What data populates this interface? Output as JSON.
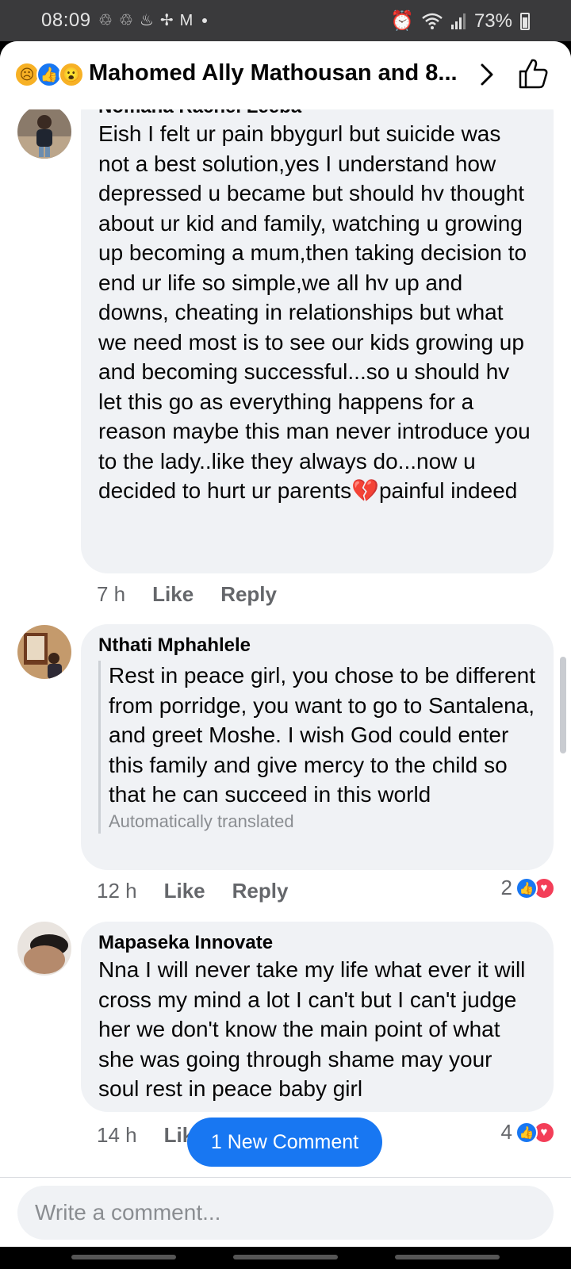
{
  "status_bar": {
    "time": "08:09",
    "battery": "73%",
    "left_icons": [
      "sync-icon",
      "sync-icon",
      "notification-icon",
      "fan-icon",
      "gmail-icon"
    ],
    "right_icons": [
      "alarm-icon",
      "wifi-icon",
      "signal-icon",
      "battery-icon"
    ]
  },
  "header": {
    "reactions": [
      "sad-reaction-icon",
      "like-reaction-icon",
      "wow-reaction-icon"
    ],
    "title": "Mahomed Ally Mathousan and 8..."
  },
  "comments": [
    {
      "author": "Nomana Rachel Leeba",
      "text": "Eish I felt ur pain bbygurl but suicide was not a best solution,yes I understand how depressed u became but should hv thought about ur kid and family, watching u growing up becoming a mum,then taking decision to end ur life so simple,we all hv up and downs, cheating in relationships but what we need most is to see our kids growing up and becoming successful...so  u should hv let this go as everything happens for a reason maybe this man never introduce you to the lady..like they always do...now u decided to hurt ur parents",
      "emoji": "💔",
      "text_after": "painful indeed",
      "time": "7 h",
      "like": "Like",
      "reply": "Reply"
    },
    {
      "author": "Nthati Mphahlele",
      "text": "Rest in peace girl, you chose to be different from porridge, you want to go to Santalena, and greet Moshe. I wish God could enter this family and give mercy to the child so that he can succeed in this world",
      "translated_note": "Automatically translated",
      "time": "12 h",
      "like": "Like",
      "reply": "Reply",
      "reaction_count": "2"
    },
    {
      "author": "Mapaseka Innovate",
      "text": "Nna I will never take my life what ever it will cross my mind a lot I can't but I can't judge her we don't know the main point of what she was going through shame may your soul rest in peace baby girl",
      "time": "14 h",
      "like": "Like",
      "reaction_count": "4"
    }
  ],
  "new_comment_label": "1 New Comment",
  "composer": {
    "placeholder": "Write a comment..."
  }
}
